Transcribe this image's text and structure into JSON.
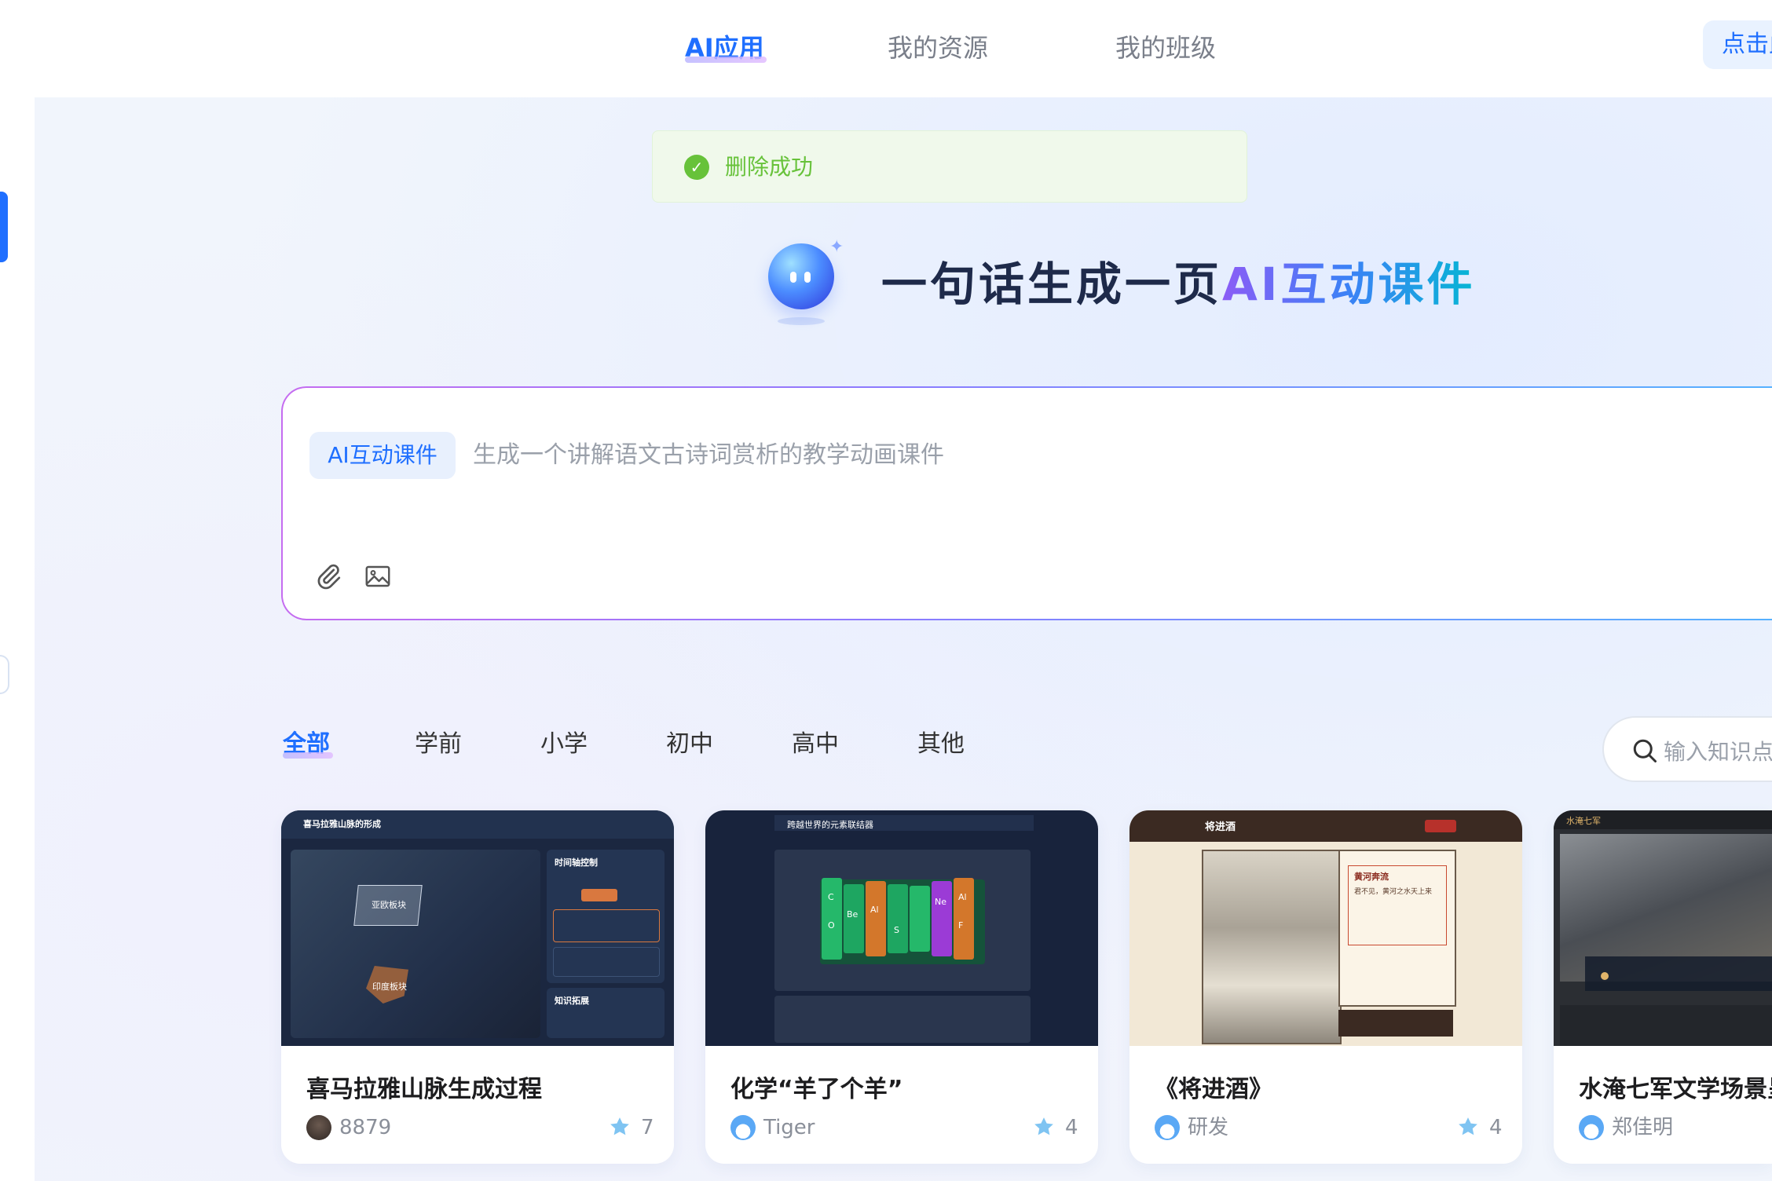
{
  "nav": {
    "items": [
      "AI应用",
      "我的资源",
      "我的班级"
    ],
    "active": "AI应用",
    "action_button": "点击此"
  },
  "toast": {
    "message": "删除成功",
    "icon": "check-circle-icon",
    "color": "#67c23a"
  },
  "hero": {
    "title_prefix": "一句话生成一页",
    "title_highlight": "AI互动课件"
  },
  "composer": {
    "mode_chip": "AI互动课件",
    "placeholder": "生成一个讲解语文古诗词赏析的教学动画课件",
    "tools": [
      "paperclip-icon",
      "image-icon"
    ]
  },
  "categories": {
    "tabs": [
      "全部",
      "学前",
      "小学",
      "初中",
      "高中",
      "其他"
    ],
    "active": "全部"
  },
  "search": {
    "placeholder": "输入知识点"
  },
  "cards": [
    {
      "title": "喜马拉雅山脉生成过程",
      "author": "8879",
      "likes": "7",
      "thumb": {
        "header": "喜马拉雅山脉的形成",
        "panel_title": "时间轴控制",
        "map_label_1": "亚欧板块",
        "map_label_2": "印度板块",
        "side_title": "知识拓展"
      }
    },
    {
      "title": "化学“羊了个羊”",
      "author": "Tiger",
      "likes": "4",
      "thumb": {
        "header": "跨越世界的元素联结器",
        "elements": [
          "C",
          "O",
          "Be",
          "Al",
          "S",
          "Ne",
          "F",
          "Al"
        ]
      }
    },
    {
      "title": "《将进酒》",
      "author": "研发",
      "likes": "4",
      "thumb": {
        "header": "将进酒",
        "poem_title": "黄河奔流",
        "poem_line": "君不见，黄河之水天上来"
      }
    },
    {
      "title": "水淹七军文学场景呈现",
      "author": "郑佳明",
      "likes": "",
      "thumb": {
        "header": "水淹七军"
      }
    }
  ],
  "colors": {
    "accent": "#1f6fff",
    "success": "#67c23a",
    "title_dark": "#1e2a4a"
  }
}
